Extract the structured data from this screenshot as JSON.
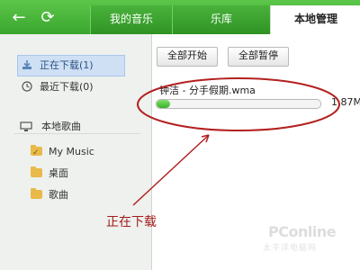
{
  "top_tabs": [
    {
      "label": "我的音乐",
      "active": false
    },
    {
      "label": "乐库",
      "active": false
    },
    {
      "label": "本地管理",
      "active": true
    }
  ],
  "sidebar": {
    "downloading": "正在下载(1)",
    "recent": "最近下载(0)",
    "local_root": "本地歌曲",
    "folders": [
      "My Music",
      "桌面",
      "歌曲"
    ]
  },
  "toolbar": {
    "start_all": "全部开始",
    "pause_all": "全部暂停"
  },
  "download": {
    "filename": "钟洁 - 分手假期.wma",
    "size_text": "1.87M",
    "progress": 0.08
  },
  "annotation": {
    "text": "正在下载"
  },
  "watermark": {
    "main": "PConline",
    "sub": "太平洋电脑网"
  },
  "colors": {
    "brand_green": "#3aa62e",
    "annotation_red": "#a31c1c",
    "progress_green": "#3bb02b"
  },
  "icons": [
    "back-arrow-icon",
    "refresh-icon",
    "download-icon",
    "clock-icon",
    "monitor-icon",
    "folder-icon"
  ]
}
